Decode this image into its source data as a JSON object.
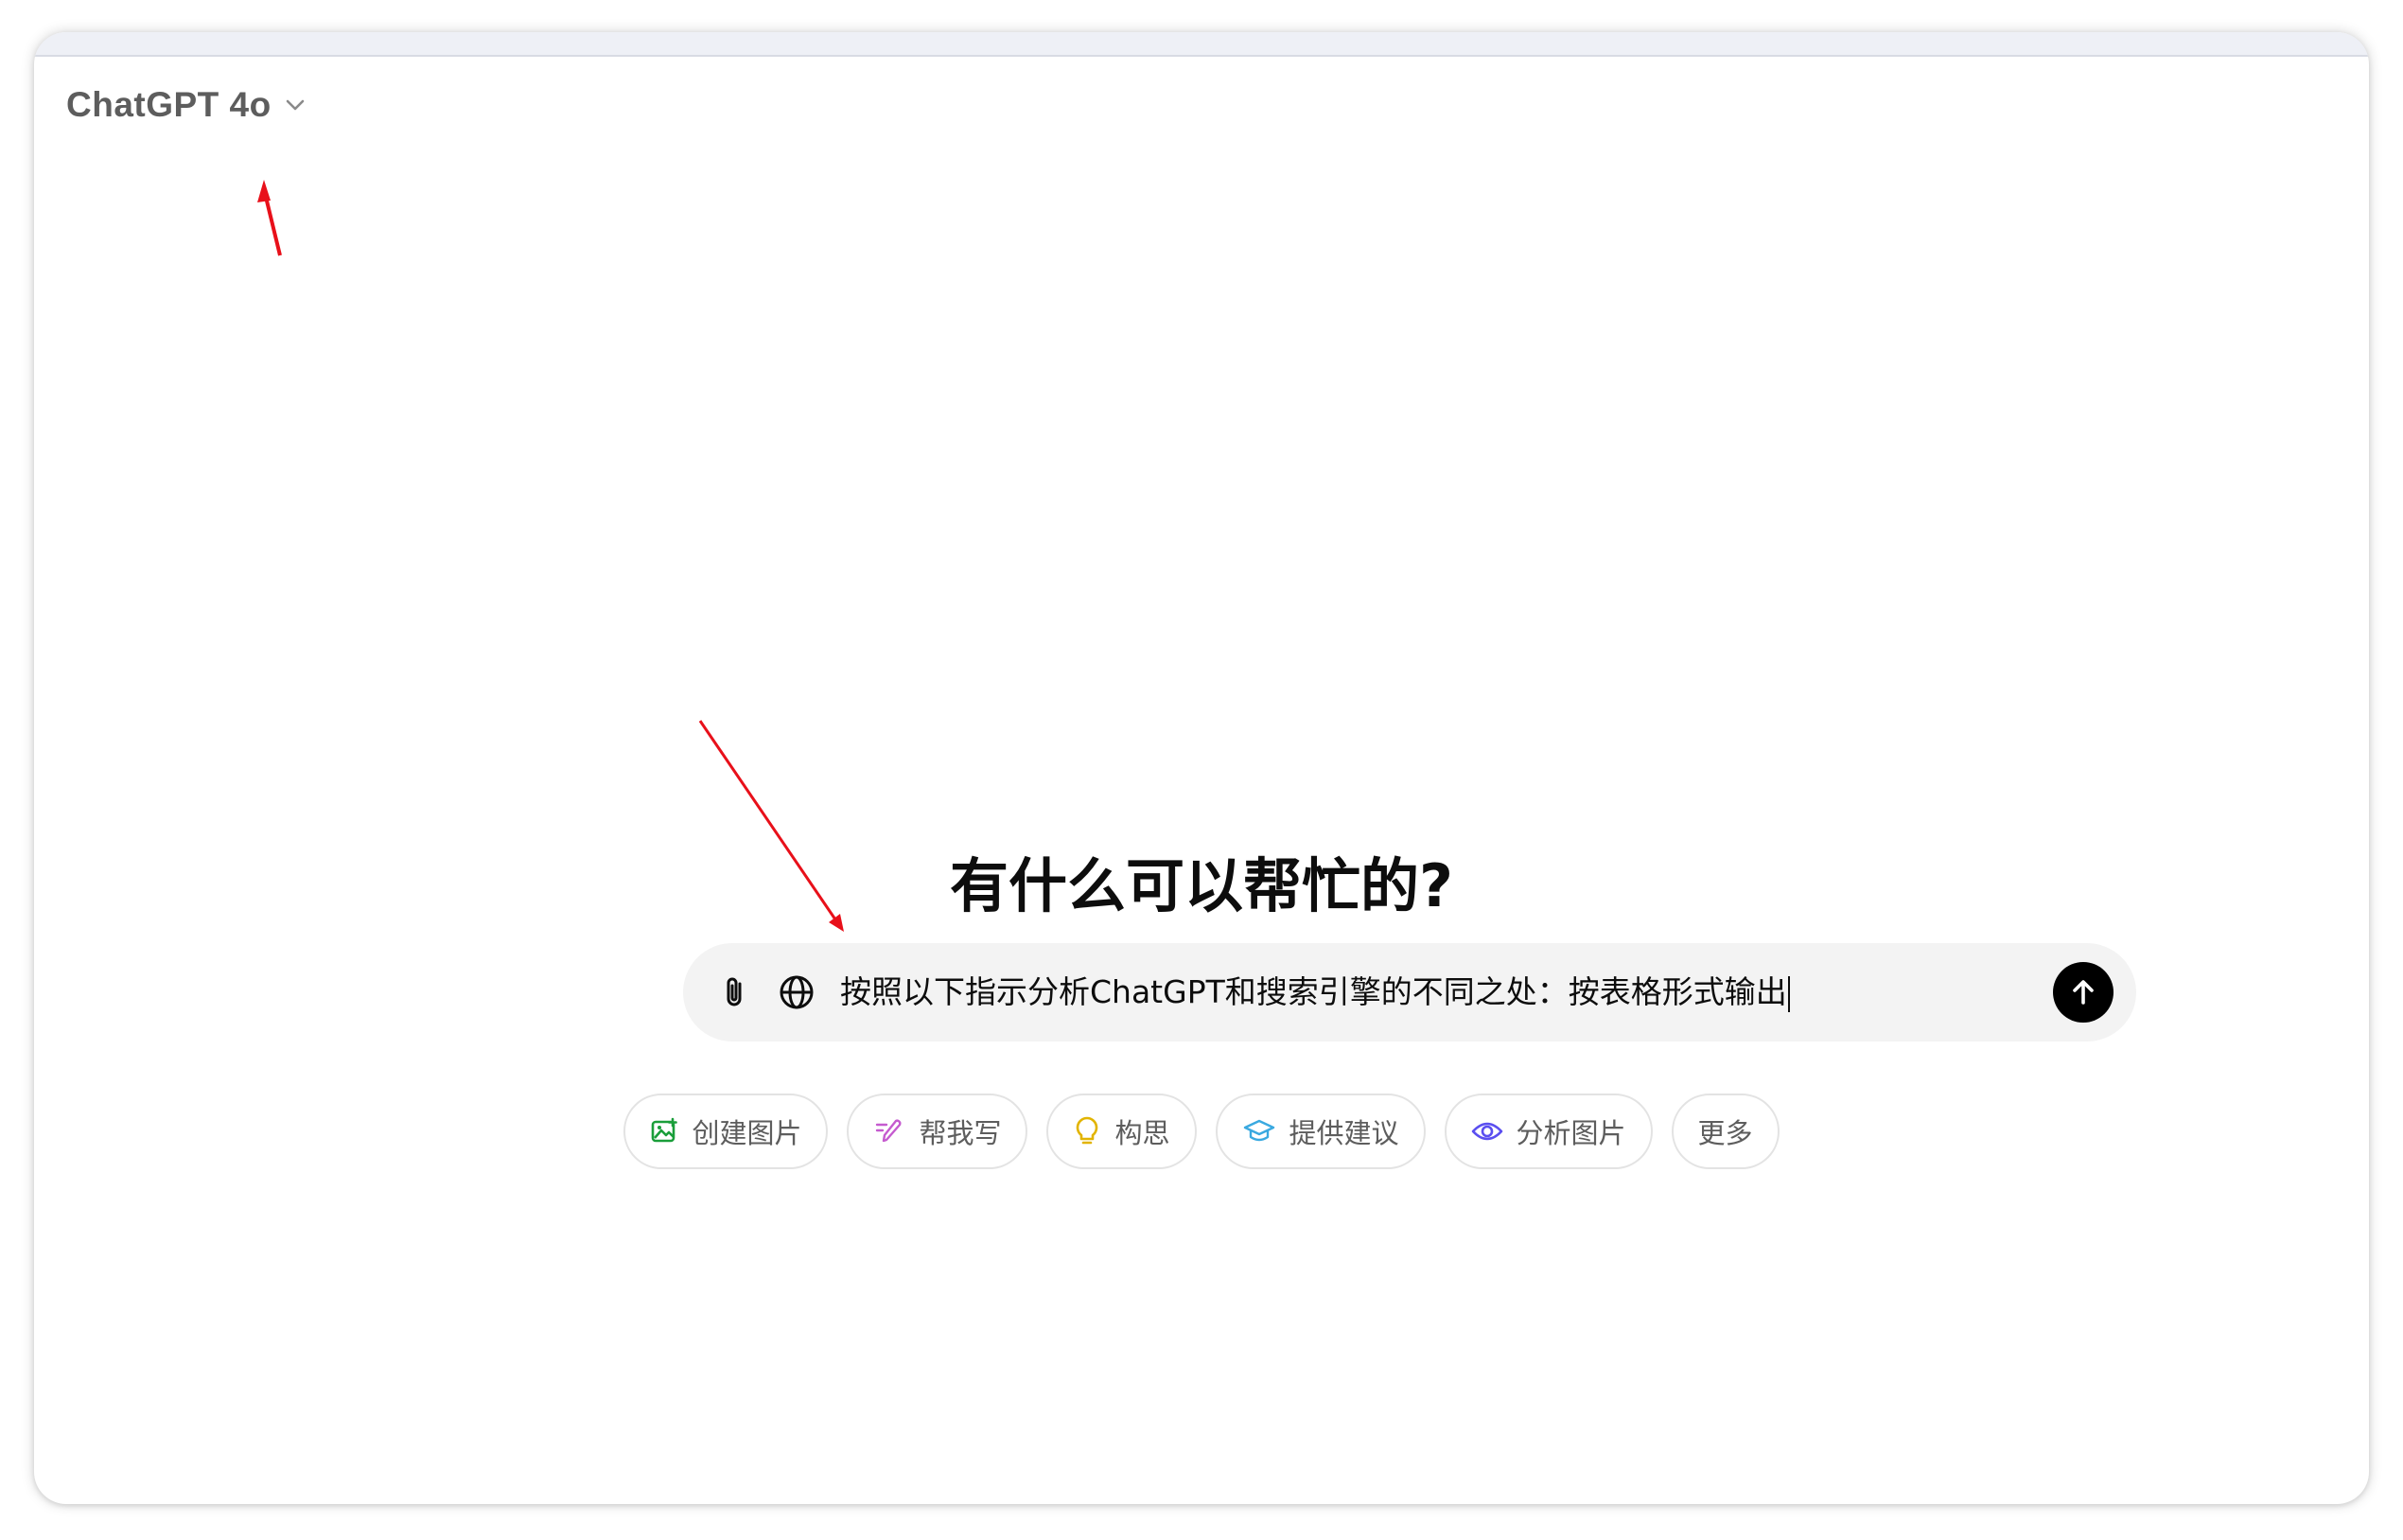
{
  "header": {
    "model_name": "ChatGPT 4o"
  },
  "main": {
    "headline": "有什么可以帮忙的?",
    "composer": {
      "prompt_text": "按照以下指示分析ChatGPT和搜索引擎的不同之处：按表格形式输出"
    },
    "chips": [
      {
        "label": "创建图片",
        "icon": "image-create-icon",
        "color": "#1a9e3a"
      },
      {
        "label": "帮我写",
        "icon": "pen-icon",
        "color": "#c55bcf"
      },
      {
        "label": "构思",
        "icon": "lightbulb-icon",
        "color": "#e2b400"
      },
      {
        "label": "提供建议",
        "icon": "graduation-cap-icon",
        "color": "#3aa9e0"
      },
      {
        "label": "分析图片",
        "icon": "eye-icon",
        "color": "#5b4ff0"
      },
      {
        "label": "更多",
        "icon": "",
        "color": ""
      }
    ]
  },
  "annotations": {
    "arrow_color": "#e8101a"
  }
}
